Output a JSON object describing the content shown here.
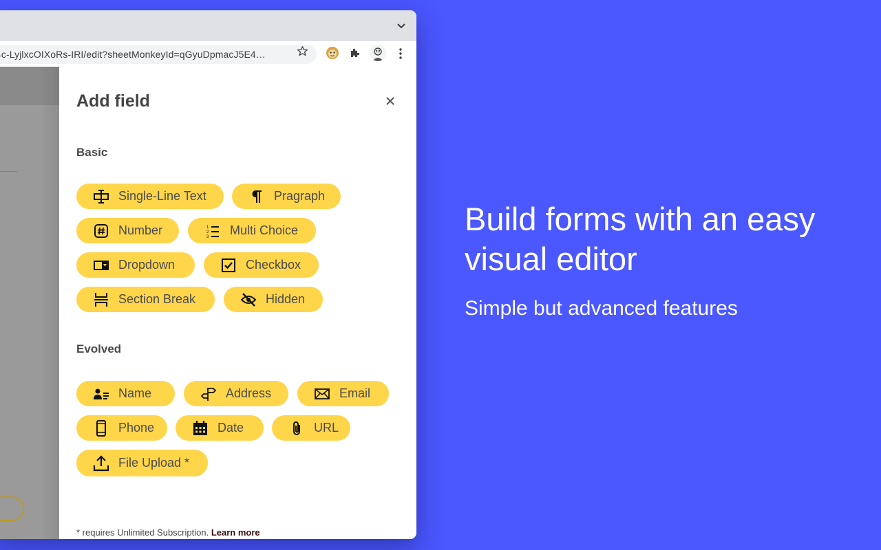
{
  "browser": {
    "url": "4c-LyjlxcOIXoRs-IRI/edit?sheetMonkeyId=qGyuDpmacJ5E4…"
  },
  "panel": {
    "title": "Add field",
    "basic_heading": "Basic",
    "basic_fields": [
      {
        "label": "Single-Line Text",
        "icon": "text-cursor-icon"
      },
      {
        "label": "Pragraph",
        "icon": "pilcrow-icon"
      },
      {
        "label": "Number",
        "icon": "hash-box-icon"
      },
      {
        "label": "Multi Choice",
        "icon": "numbered-list-icon"
      },
      {
        "label": "Dropdown",
        "icon": "dropdown-icon"
      },
      {
        "label": "Checkbox",
        "icon": "checkbox-icon"
      },
      {
        "label": "Section Break",
        "icon": "section-break-icon"
      },
      {
        "label": "Hidden",
        "icon": "eye-off-icon"
      }
    ],
    "evolved_heading": "Evolved",
    "evolved_fields": [
      {
        "label": "Name",
        "icon": "person-card-icon"
      },
      {
        "label": "Address",
        "icon": "signpost-icon"
      },
      {
        "label": "Email",
        "icon": "envelope-icon"
      },
      {
        "label": "Phone",
        "icon": "phone-icon"
      },
      {
        "label": "Date",
        "icon": "calendar-icon"
      },
      {
        "label": "URL",
        "icon": "paperclip-icon"
      },
      {
        "label": "File Upload *",
        "icon": "upload-icon"
      }
    ],
    "footnote": "* requires Unlimited Subscription.",
    "footnote_link": "Learn more"
  },
  "promo": {
    "headline": "Build forms with an easy visual editor",
    "subhead": "Simple but advanced features"
  },
  "colors": {
    "background": "#4b57ff",
    "chip": "#ffd54a"
  }
}
